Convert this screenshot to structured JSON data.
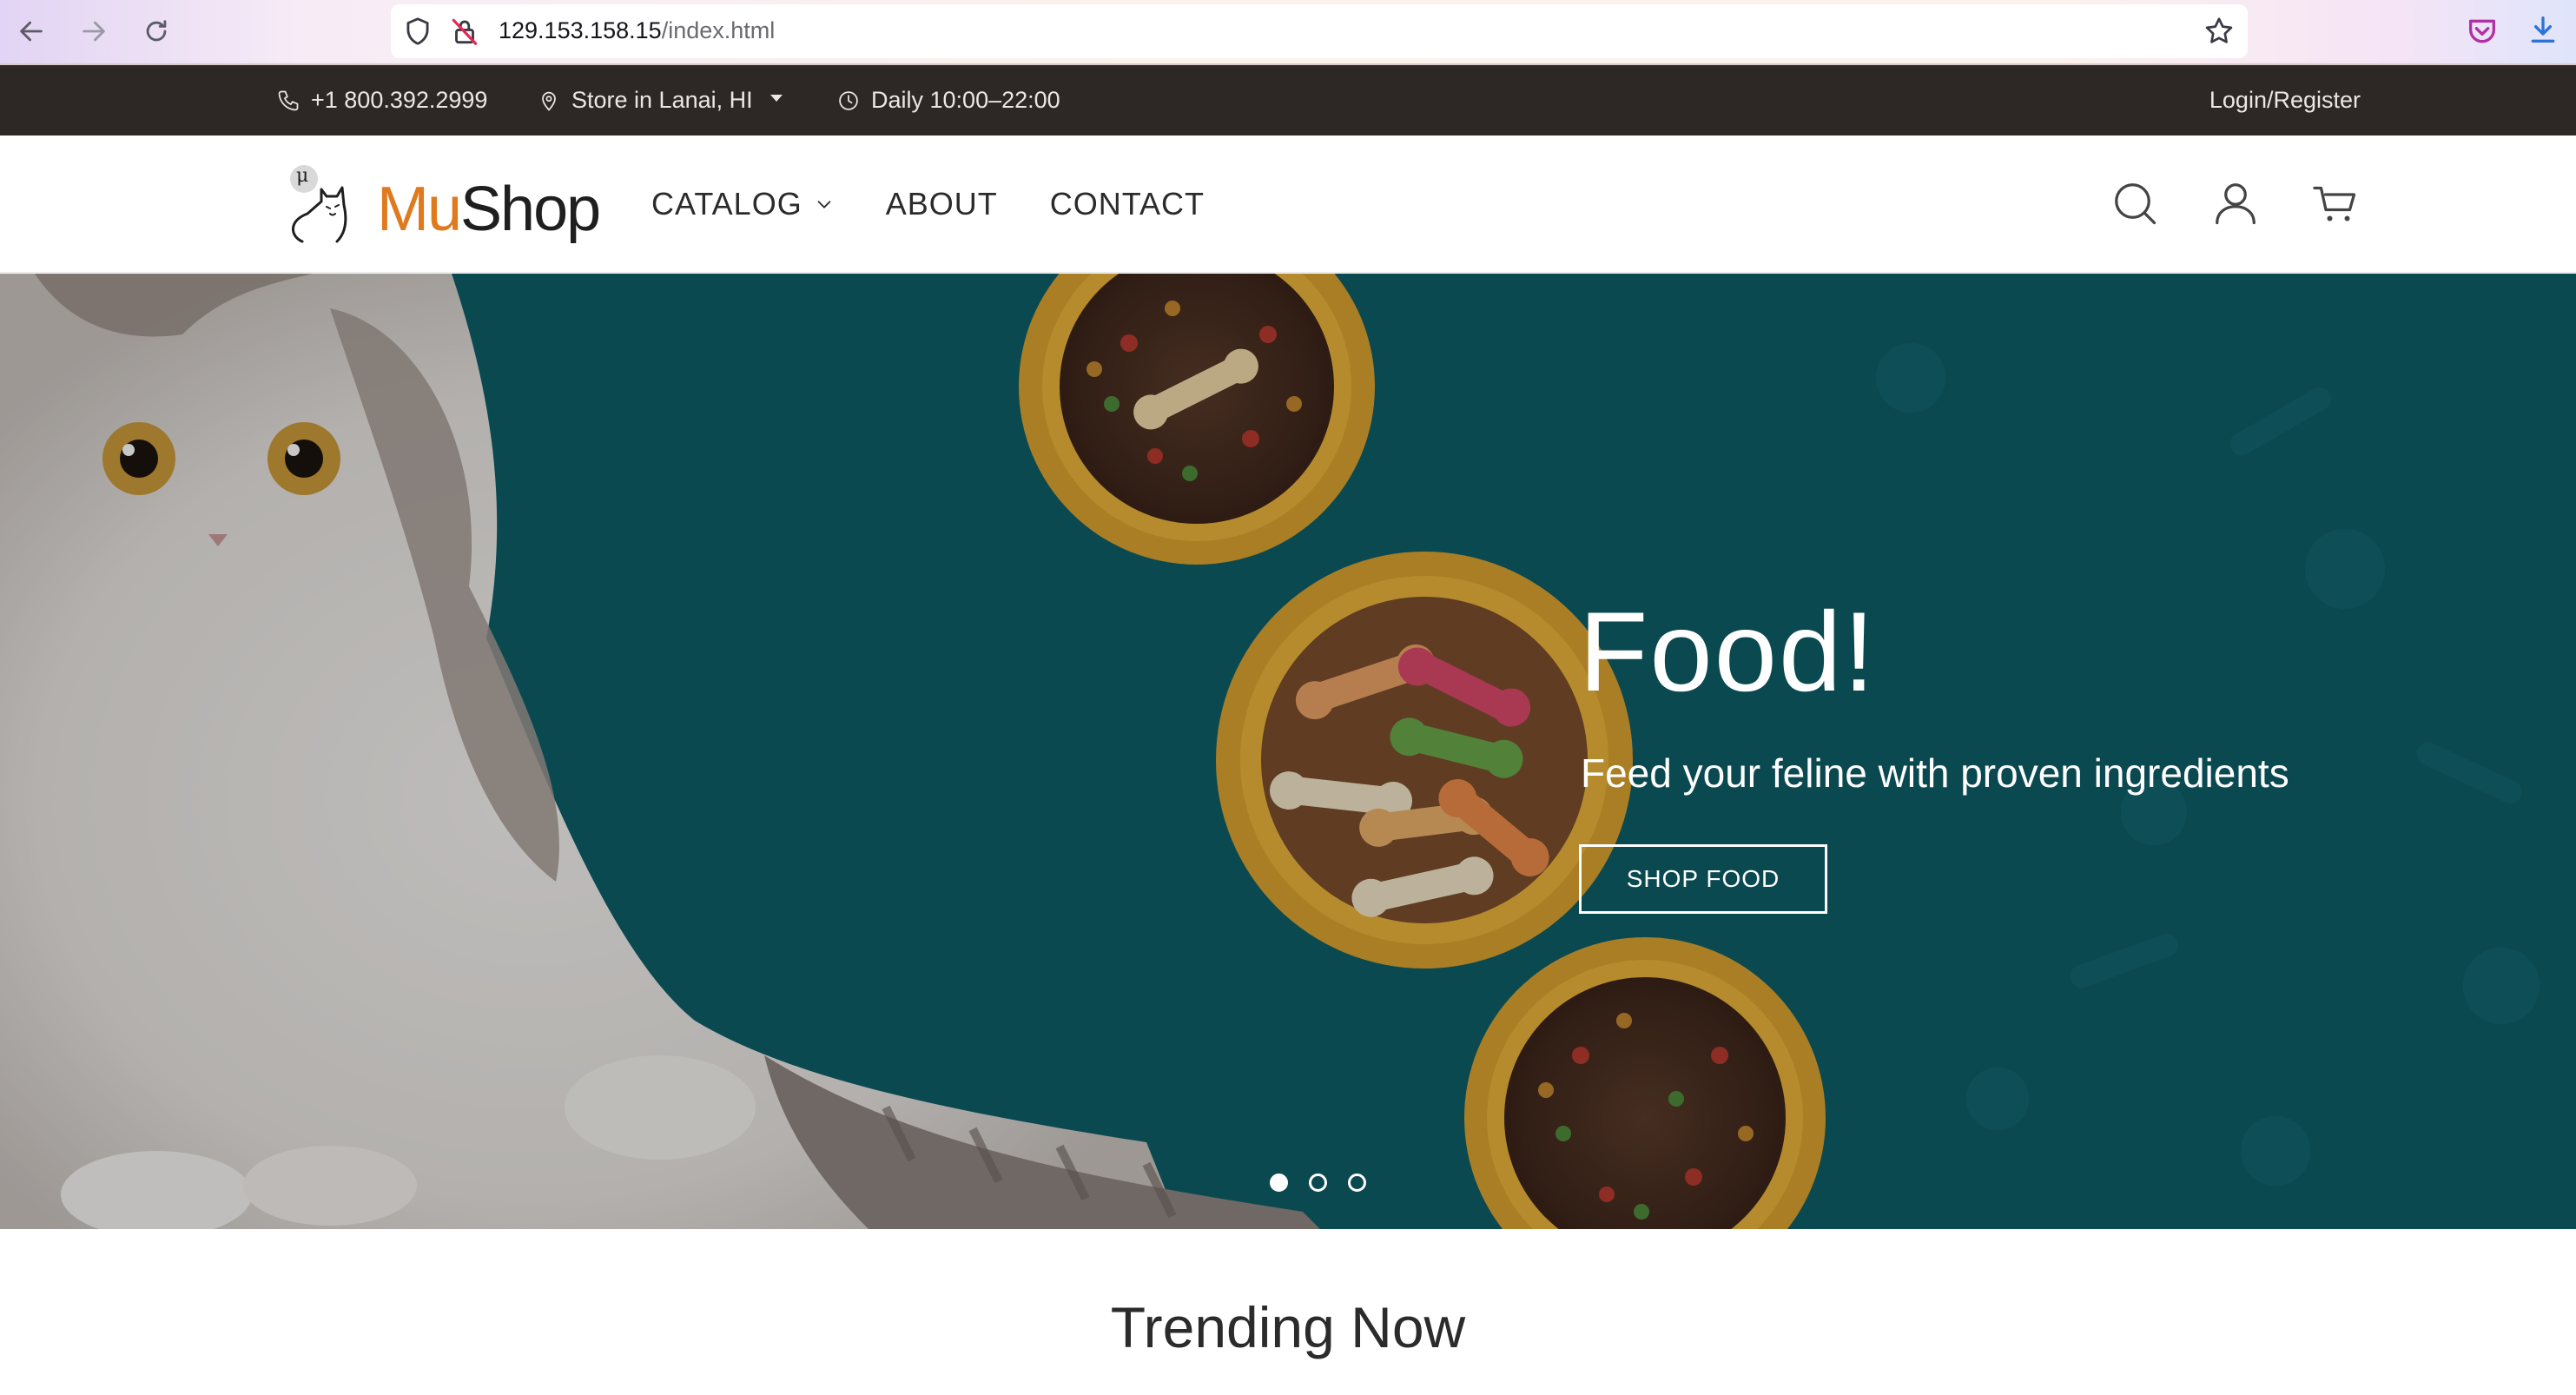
{
  "browser": {
    "url_host": "129.153.158.15",
    "url_path": "/index.html",
    "toolbar_icons": [
      "back-icon",
      "forward-icon",
      "reload-icon",
      "shield-icon",
      "lock-slash-icon",
      "star-icon",
      "pocket-icon",
      "download-icon"
    ]
  },
  "topbar": {
    "phone": "+1 800.392.2999",
    "store": "Store in Lanai, HI",
    "hours": "Daily 10:00–22:00",
    "login": "Login/Register"
  },
  "header": {
    "logo_mu": "Mu",
    "logo_shop": "Shop",
    "logo_badge": "μ",
    "nav": {
      "catalog": "CATALOG",
      "about": "ABOUT",
      "contact": "CONTACT"
    },
    "icons": [
      "search-icon",
      "user-icon",
      "cart-icon"
    ]
  },
  "hero": {
    "title": "Food!",
    "subtitle": "Feed your feline with proven ingredients",
    "button": "SHOP FOOD",
    "slides": 3,
    "active_slide": 1,
    "colors": {
      "background": "#0e5d67",
      "bowl": "#e8b23a"
    }
  },
  "sections": {
    "trending_title": "Trending Now"
  }
}
